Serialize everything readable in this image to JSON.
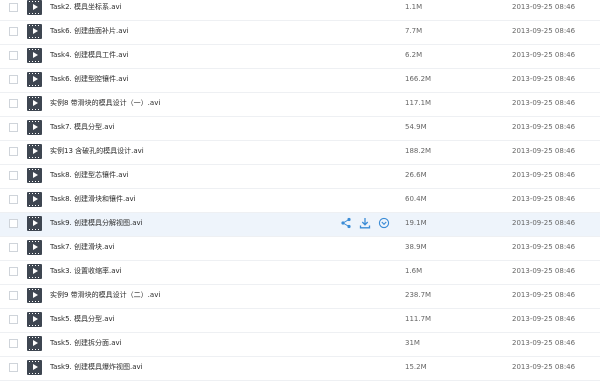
{
  "files": [
    {
      "name": "Task2. 模具坐标系.avi",
      "size": "1.1M",
      "date": "2013-09-25 08:46"
    },
    {
      "name": "Task6. 创建曲面补片.avi",
      "size": "7.7M",
      "date": "2013-09-25 08:46"
    },
    {
      "name": "Task4. 创建模具工件.avi",
      "size": "6.2M",
      "date": "2013-09-25 08:46"
    },
    {
      "name": "Task6. 创建型腔镶件.avi",
      "size": "166.2M",
      "date": "2013-09-25 08:46"
    },
    {
      "name": "实例8  带滑块的模具设计（一）.avi",
      "size": "117.1M",
      "date": "2013-09-25 08:46"
    },
    {
      "name": "Task7. 模具分型.avi",
      "size": "54.9M",
      "date": "2013-09-25 08:46"
    },
    {
      "name": "实例13  含破孔的模具设计.avi",
      "size": "188.2M",
      "date": "2013-09-25 08:46"
    },
    {
      "name": "Task8. 创建型芯镶件.avi",
      "size": "26.6M",
      "date": "2013-09-25 08:46"
    },
    {
      "name": "Task8. 创建滑块和镶件.avi",
      "size": "60.4M",
      "date": "2013-09-25 08:46"
    },
    {
      "name": "Task9. 创建模具分解视图.avi",
      "size": "19.1M",
      "date": "2013-09-25 08:46",
      "hover": true
    },
    {
      "name": "Task7. 创建滑块.avi",
      "size": "38.9M",
      "date": "2013-09-25 08:46"
    },
    {
      "name": "Task3. 设置收缩率.avi",
      "size": "1.6M",
      "date": "2013-09-25 08:46"
    },
    {
      "name": "实例9  带滑块的模具设计（二）.avi",
      "size": "238.7M",
      "date": "2013-09-25 08:46"
    },
    {
      "name": "Task5. 模具分型.avi",
      "size": "111.7M",
      "date": "2013-09-25 08:46"
    },
    {
      "name": "Task5. 创建拆分面.avi",
      "size": "31M",
      "date": "2013-09-25 08:46"
    },
    {
      "name": "Task9. 创建模具爆炸视图.avi",
      "size": "15.2M",
      "date": "2013-09-25 08:46"
    }
  ],
  "row_actions": [
    "share-icon",
    "download-icon",
    "more-icon"
  ],
  "colors": {
    "accent": "#3b8cd6",
    "row_hover": "#eef4fb",
    "video_icon": "#3e4651"
  }
}
